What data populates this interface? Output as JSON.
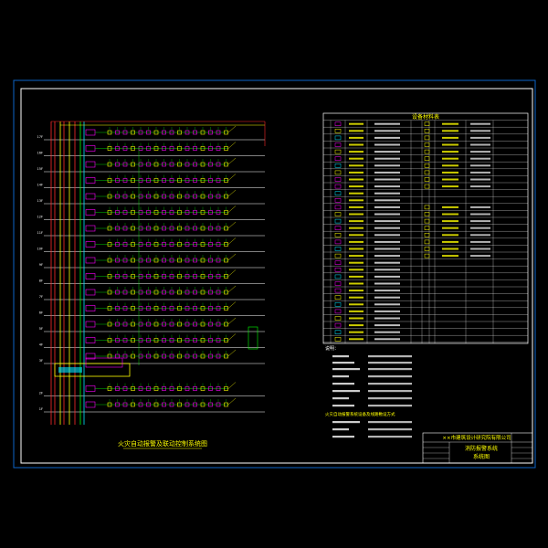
{
  "drawing": {
    "diagram_caption": "火灾自动报警及联动控制系统图",
    "legend_header": "设备材料表",
    "notes_header": "说明：",
    "notes_subheader": "火灾自动报警系统设备及线路敷设方式",
    "title_block": {
      "company": "××市建筑设计研究院有限公司",
      "drawing_name_line1": "消防报警系统",
      "drawing_name_line2": "系统图"
    }
  },
  "colors": {
    "frame": "#0d63c8",
    "border": "#ffffff",
    "riser_red": "#ff2b2b",
    "riser_yellow": "#ffff00",
    "riser_green": "#00ff00",
    "riser_cyan": "#00e5ff",
    "device_magenta": "#ff00ff",
    "floor_line": "#ffffff"
  },
  "floors": [
    "17F",
    "16F",
    "15F",
    "14F",
    "13F",
    "12F",
    "11F",
    "10F",
    "9F",
    "8F",
    "7F",
    "6F",
    "5F",
    "4F",
    "3F",
    "2F",
    "1F"
  ]
}
